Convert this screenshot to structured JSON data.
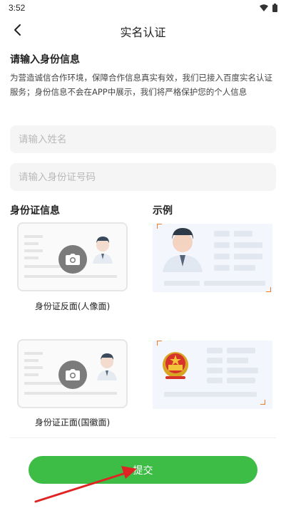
{
  "status_bar": {
    "time": "3:52",
    "icons": [
      "wifi-icon",
      "battery-icon"
    ]
  },
  "nav": {
    "title": "实名认证",
    "back_icon": "chevron-left-icon"
  },
  "form": {
    "section_title": "请输入身份信息",
    "description": "为营造诚信合作环境，保障合作信息真实有效，我们已接入百度实名认证服务；身份信息不会在APP中展示，我们将严格保护您的个人信息",
    "name_placeholder": "请输入姓名",
    "id_placeholder": "请输入身份证号码"
  },
  "id_info": {
    "title": "身份证信息",
    "example_title": "示例",
    "back_caption": "身份证反面(人像面)",
    "front_caption": "身份证正面(国徽面)"
  },
  "submit_label": "提交",
  "colors": {
    "accent": "#3dbd45",
    "annotation_arrow": "#e02424",
    "corner_mark": "#f07b25"
  }
}
